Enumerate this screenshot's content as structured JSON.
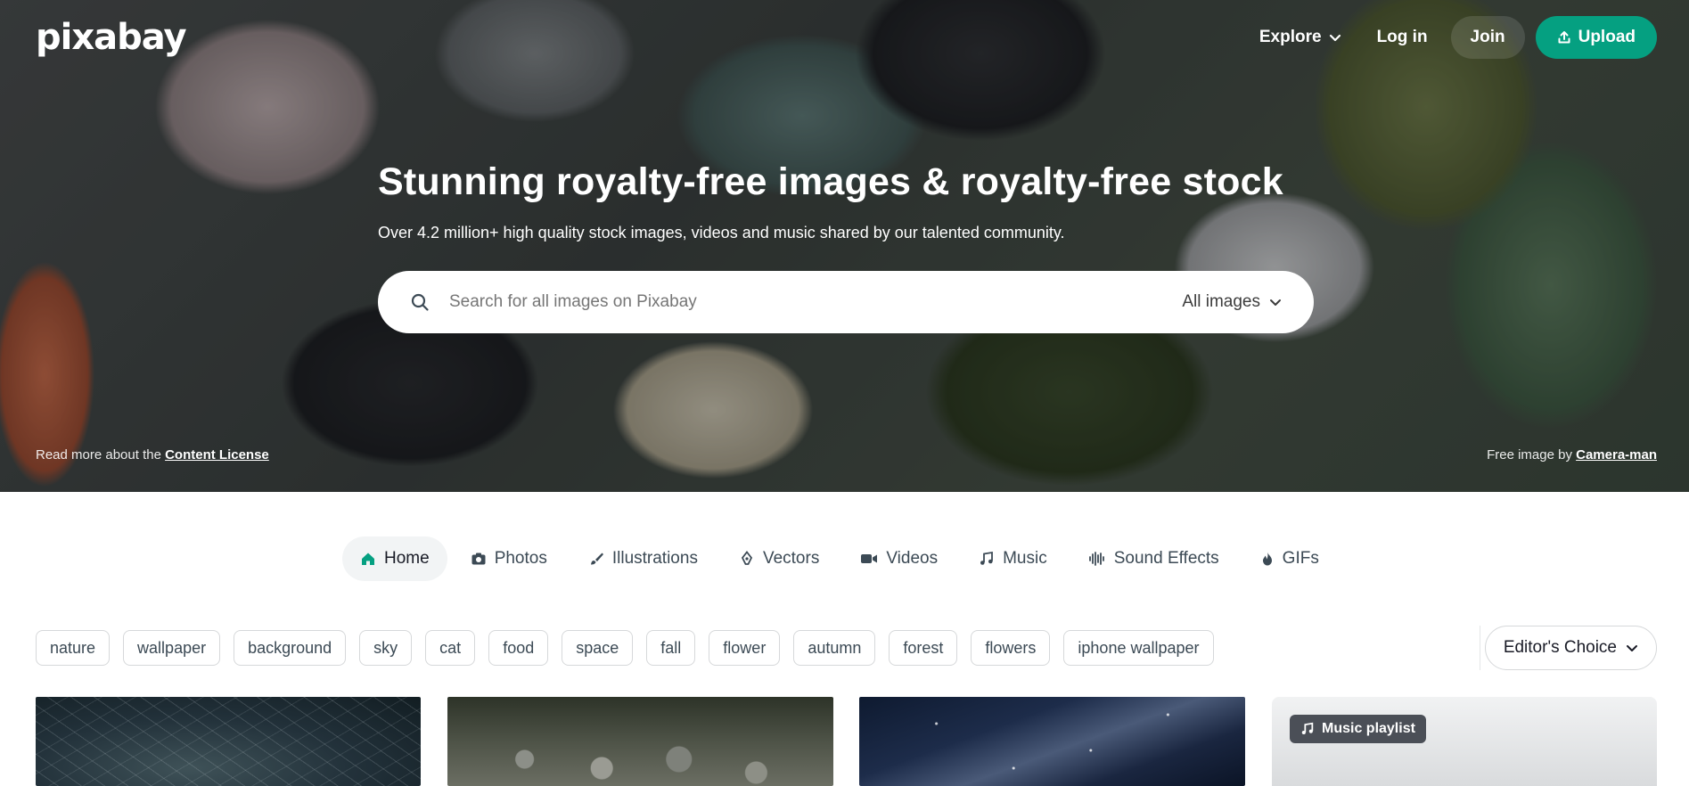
{
  "header": {
    "logo": "pixabay",
    "nav": {
      "explore": "Explore",
      "login": "Log in",
      "join": "Join",
      "upload": "Upload"
    }
  },
  "hero": {
    "title": "Stunning royalty-free images & royalty-free stock",
    "subtitle": "Over 4.2 million+ high quality stock images, videos and music shared by our talented community.",
    "search": {
      "placeholder": "Search for all images on Pixabay",
      "type_selected": "All images"
    },
    "license_prefix": "Read more about the ",
    "license_link": "Content License",
    "credit_prefix": "Free image by ",
    "credit_link": "Camera-man"
  },
  "tabs": [
    {
      "label": "Home",
      "icon": "home-icon",
      "active": true
    },
    {
      "label": "Photos",
      "icon": "camera-icon"
    },
    {
      "label": "Illustrations",
      "icon": "brush-icon"
    },
    {
      "label": "Vectors",
      "icon": "pen-nib-icon"
    },
    {
      "label": "Videos",
      "icon": "video-icon"
    },
    {
      "label": "Music",
      "icon": "music-note-icon"
    },
    {
      "label": "Sound Effects",
      "icon": "waveform-icon"
    },
    {
      "label": "GIFs",
      "icon": "flame-icon"
    }
  ],
  "tags": [
    "nature",
    "wallpaper",
    "background",
    "sky",
    "cat",
    "food",
    "space",
    "fall",
    "flower",
    "autumn",
    "forest",
    "flowers",
    "iphone wallpaper"
  ],
  "sort": {
    "label": "Editor's Choice"
  },
  "playlist": {
    "badge": "Music playlist"
  },
  "colors": {
    "accent": "#05a081",
    "tab_active_bg": "#f2f4f5",
    "text_dark": "#191b26"
  }
}
